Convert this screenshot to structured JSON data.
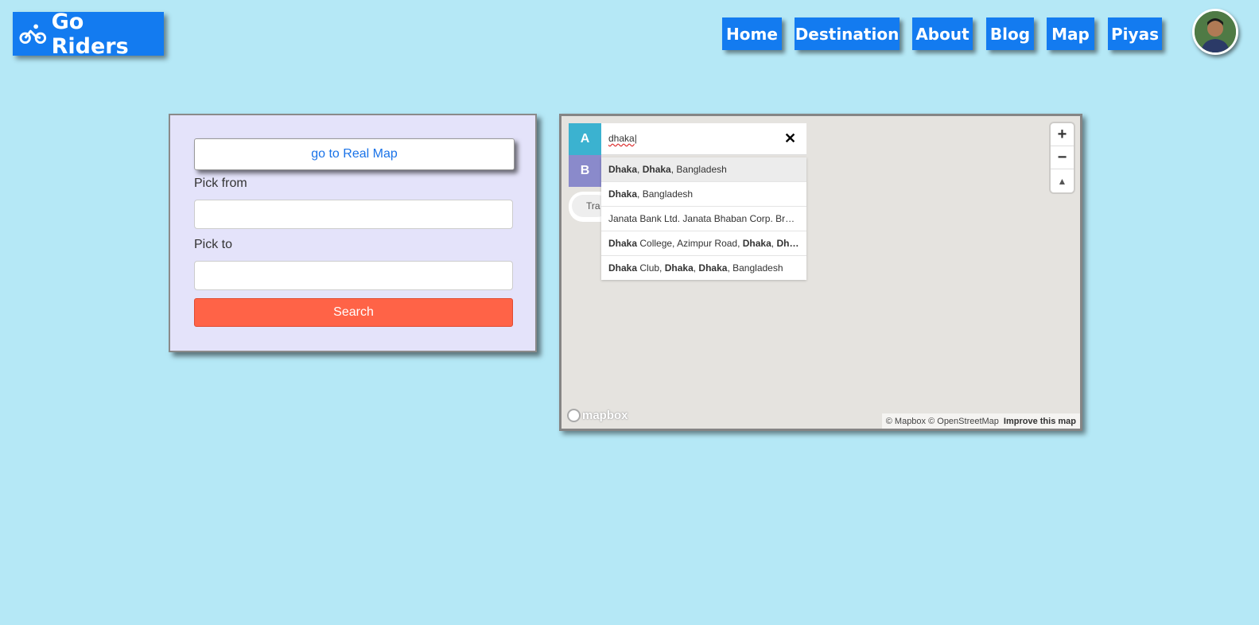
{
  "brand": {
    "name": "Go Riders",
    "icon": "bicycle-icon"
  },
  "nav": {
    "items": [
      {
        "label": "Home"
      },
      {
        "label": "Destination"
      },
      {
        "label": "About"
      },
      {
        "label": "Blog"
      },
      {
        "label": "Map"
      },
      {
        "label": "Piyas"
      }
    ]
  },
  "form": {
    "real_map_label": "go to Real Map",
    "pick_from_label": "Pick from",
    "pick_from_value": "",
    "pick_to_label": "Pick to",
    "pick_to_value": "",
    "search_label": "Search"
  },
  "map": {
    "origin_marker": "A",
    "destination_marker": "B",
    "origin_value": "dhaka",
    "profile_label": "Tra",
    "suggestions": [
      {
        "parts": [
          [
            "Dhaka",
            true
          ],
          [
            ", ",
            false
          ],
          [
            "Dhaka",
            true
          ],
          [
            ", Bangladesh",
            false
          ]
        ]
      },
      {
        "parts": [
          [
            "Dhaka",
            true
          ],
          [
            ", Bangladesh",
            false
          ]
        ]
      },
      {
        "parts": [
          [
            "Janata Bank Ltd. Janata Bhaban Corp. Br…",
            false
          ]
        ]
      },
      {
        "parts": [
          [
            "Dhaka",
            true
          ],
          [
            " College, Azimpur Road, ",
            false
          ],
          [
            "Dhaka",
            true
          ],
          [
            ", ",
            false
          ],
          [
            "Dh…",
            true
          ]
        ]
      },
      {
        "parts": [
          [
            "Dhaka",
            true
          ],
          [
            " Club, ",
            false
          ],
          [
            "Dhaka",
            true
          ],
          [
            ", ",
            false
          ],
          [
            "Dhaka",
            true
          ],
          [
            ", Bangladesh",
            false
          ]
        ]
      }
    ],
    "zoom_in": "+",
    "zoom_out": "−",
    "compass": "▲",
    "logo_text": "mapbox",
    "attribution": "© Mapbox © OpenStreetMap",
    "improve_label": "Improve this map"
  },
  "colors": {
    "accent": "#137bf0",
    "background": "#b5e8f6",
    "search": "#ff6347"
  }
}
